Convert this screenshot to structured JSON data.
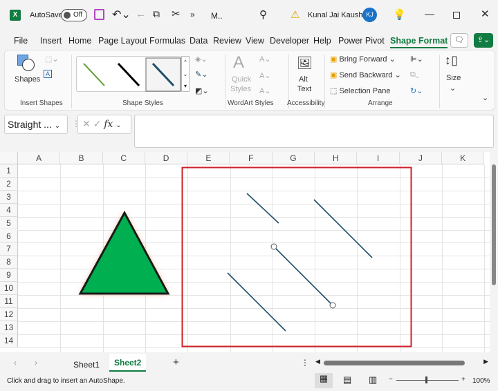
{
  "titlebar": {
    "autosave": "AutoSave",
    "toggle": "Off",
    "filename": "M..",
    "user": "Kunal Jai Kaushik",
    "initials": "KJ"
  },
  "tabs": [
    "File",
    "Insert",
    "Home",
    "Page Layout",
    "Formulas",
    "Data",
    "Review",
    "View",
    "Developer",
    "Help",
    "Power Pivot",
    "Shape Format"
  ],
  "ribbon": {
    "shapes": "Shapes",
    "insert_shapes": "Insert Shapes",
    "shape_styles": "Shape Styles",
    "quick_styles_1": "Quick",
    "quick_styles_2": "Styles",
    "wordart_styles": "WordArt Styles",
    "alt_1": "Alt",
    "alt_2": "Text",
    "accessibility": "Accessibility",
    "bring_forward": "Bring Forward",
    "send_backward": "Send Backward",
    "selection_pane": "Selection Pane",
    "arrange": "Arrange",
    "size": "Size"
  },
  "formula": {
    "name_box": "Straight ...",
    "fx": "fx",
    "value": ""
  },
  "columns": [
    "A",
    "B",
    "C",
    "D",
    "E",
    "F",
    "G",
    "H",
    "I",
    "J",
    "K"
  ],
  "rows": [
    "1",
    "2",
    "3",
    "4",
    "5",
    "6",
    "7",
    "8",
    "9",
    "10",
    "11",
    "12",
    "13",
    "14"
  ],
  "sheets": [
    "Sheet1",
    "Sheet2"
  ],
  "status": {
    "message": "Click and drag to insert an AutoShape.",
    "zoom": "100%"
  },
  "colors": {
    "accent": "#107c41",
    "line": "#1f4e69",
    "triangle": "#00b050",
    "selection": "#d0202a"
  }
}
